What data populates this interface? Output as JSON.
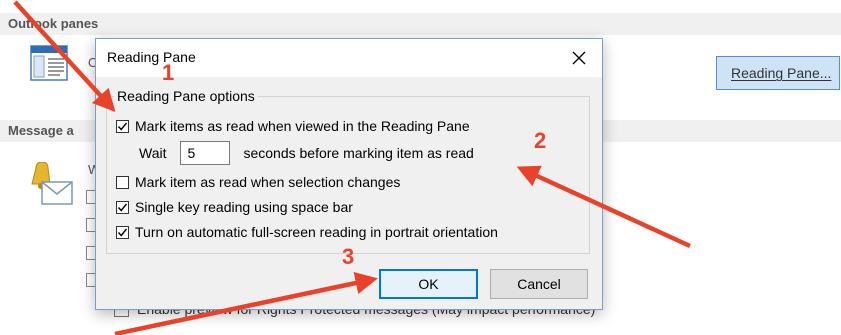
{
  "background": {
    "section_outlook_panes": "Outlook panes",
    "section_message_arrival": "Message a",
    "reading_pane_button": "Reading Pane...",
    "frag_o": "O",
    "frag_w": "W",
    "enable_preview_label": "Enable preview for Rights Protected messages (May impact performance)"
  },
  "dialog": {
    "title": "Reading Pane",
    "group_label": "Reading Pane options",
    "options": [
      {
        "label": "Mark items as read when viewed in the Reading Pane",
        "checked": true
      },
      {
        "label": "Mark item as read when selection changes",
        "checked": false
      },
      {
        "label": "Single key reading using space bar",
        "checked": true
      },
      {
        "label": "Turn on automatic full-screen reading in portrait orientation",
        "checked": true
      }
    ],
    "wait_label": "Wait",
    "wait_value": "5",
    "wait_suffix": "seconds before marking item as read",
    "ok_label": "OK",
    "cancel_label": "Cancel"
  },
  "annotations": {
    "marker_1": "1",
    "marker_2": "2",
    "marker_3": "3",
    "color": "#e8432a"
  },
  "colors": {
    "dialog_bg": "#f0f0f0",
    "ok_border": "#0078d7",
    "reading_pane_button_bg": "#cfe3f7"
  }
}
